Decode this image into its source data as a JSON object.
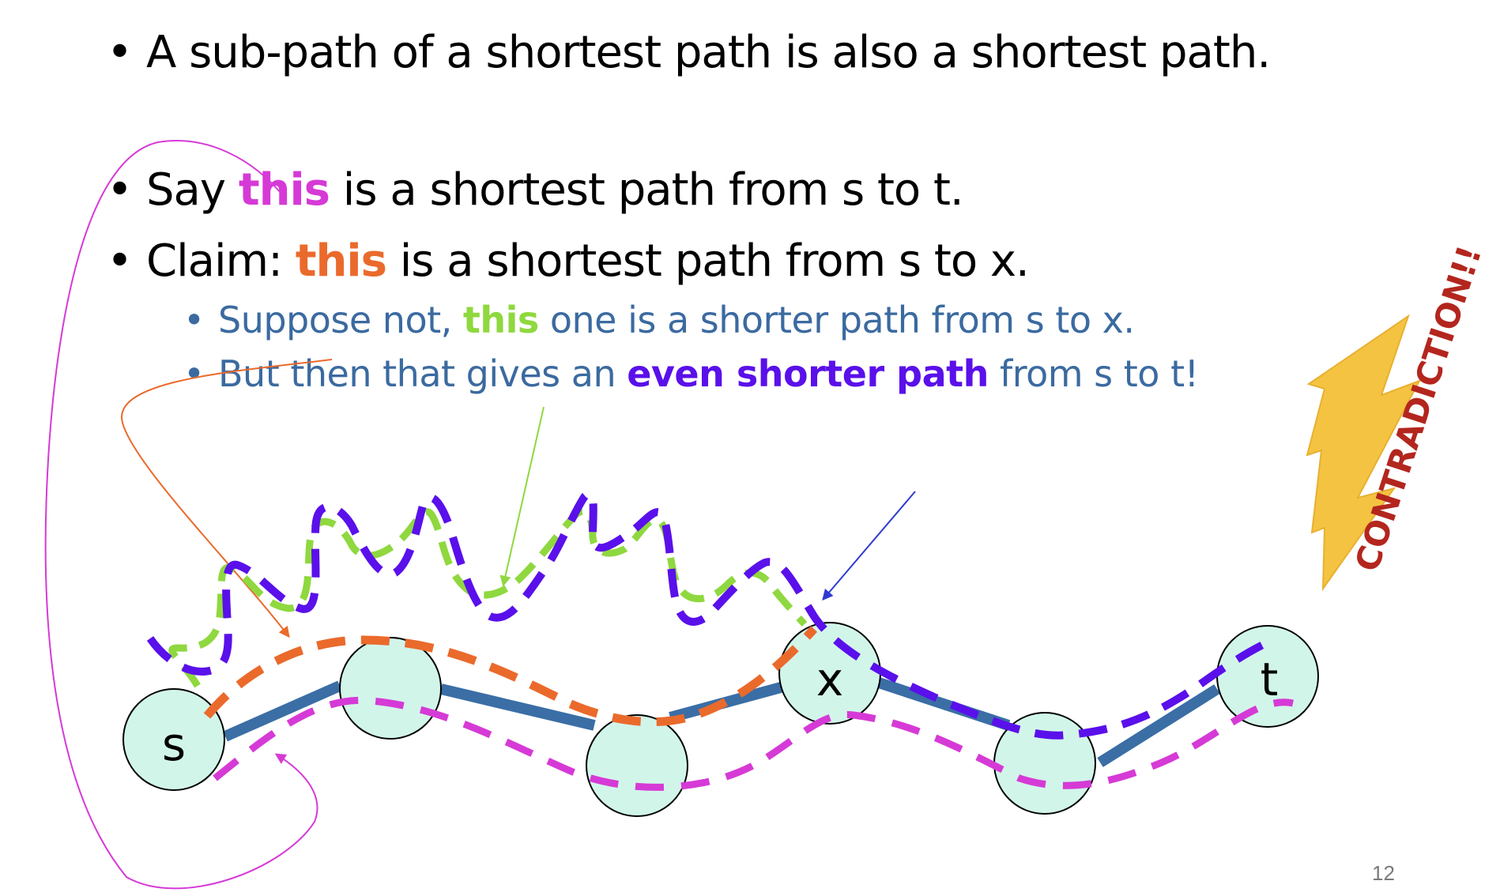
{
  "bullets": {
    "b1": {
      "text": "A sub-path of a shortest path is also a shortest path."
    },
    "b2": {
      "pre": "Say ",
      "highlight": "this",
      "post": " is a shortest path from s to t."
    },
    "b3": {
      "pre": "Claim: ",
      "highlight": "this",
      "post": " is a shortest path from s to x."
    },
    "s1": {
      "pre": "Suppose not, ",
      "highlight": "this",
      "post": " one is a shorter path from s to x."
    },
    "s2": {
      "pre": "But then that gives an ",
      "highlight": "even shorter path",
      "post": " from s to t!"
    }
  },
  "bullet_symbol": "•",
  "nodes": {
    "s": "s",
    "x": "x",
    "t": "t"
  },
  "contradiction": "CONTRADICTION!!",
  "page_number": "12",
  "colors": {
    "magenta": "#d63ad6",
    "orange": "#ea6a2c",
    "green": "#8fd83f",
    "purple": "#5a10ea",
    "sub_bullet_blue": "#3b6aa0",
    "edge_blue": "#3a6ea5",
    "node_fill": "#d2f5ea",
    "bolt_yellow": "#f5c342",
    "contradiction_red": "#b3261e"
  }
}
